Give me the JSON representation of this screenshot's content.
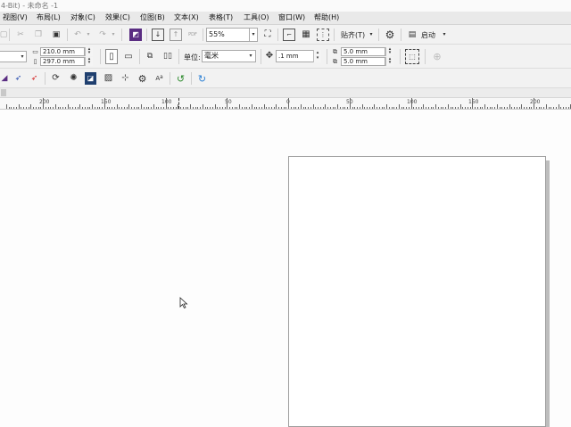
{
  "window": {
    "title": "4-Bit) - 未命名 -1"
  },
  "menu": [
    {
      "label": "视图(V)"
    },
    {
      "label": "布局(L)"
    },
    {
      "label": "对象(C)"
    },
    {
      "label": "效果(C)"
    },
    {
      "label": "位图(B)"
    },
    {
      "label": "文本(X)"
    },
    {
      "label": "表格(T)"
    },
    {
      "label": "工具(O)"
    },
    {
      "label": "窗口(W)"
    },
    {
      "label": "帮助(H)"
    }
  ],
  "standard_toolbar": {
    "zoom_value": "55%",
    "snap_label": "贴齐(T)",
    "launch_label": "启动"
  },
  "property_bar": {
    "width_value": "210.0 mm",
    "height_value": "297.0 mm",
    "unit_label": "单位:",
    "unit_value": "毫米",
    "nudge_value": ".1 mm",
    "dup_x_value": "5.0 mm",
    "dup_y_value": "5.0 mm"
  },
  "ruler": {
    "labels": [
      "200",
      "150",
      "100",
      "50",
      "0",
      "50",
      "100",
      "150",
      "200"
    ]
  },
  "colors": {
    "toolbar_bg": "#f2f2f2",
    "menubar_bg": "#e9e9e9",
    "accent_purple": "#5a2d82",
    "undo_green": "#2e8b2e",
    "redo_blue": "#2a7fd4",
    "pick_red": "#d42a2a"
  }
}
